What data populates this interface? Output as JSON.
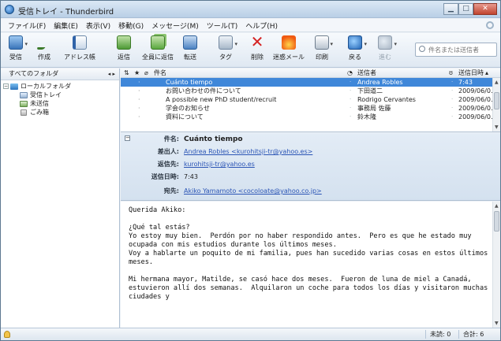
{
  "window": {
    "title": "受信トレイ - Thunderbird"
  },
  "menu": [
    "ファイル(F)",
    "編集(E)",
    "表示(V)",
    "移動(G)",
    "メッセージ(M)",
    "ツール(T)",
    "ヘルプ(H)"
  ],
  "toolbar": {
    "get": "受信",
    "write": "作成",
    "addressbook": "アドレス帳",
    "reply": "返信",
    "replyall": "全員に返信",
    "forward": "転送",
    "tag": "タグ",
    "delete": "削除",
    "junk": "迷惑メール",
    "print": "印刷",
    "back": "戻る",
    "forward_nav": "進む",
    "search_placeholder": "件名または送信者"
  },
  "folders": {
    "header": "すべてのフォルダ",
    "header_arrows": "◂ ▸",
    "items": [
      {
        "label": "ローカルフォルダ",
        "icon": "local-folders-icon"
      },
      {
        "label": "受信トレイ",
        "icon": "inbox-icon"
      },
      {
        "label": "未送信",
        "icon": "unsent-icon"
      },
      {
        "label": "ごみ箱",
        "icon": "trash-icon"
      }
    ]
  },
  "threads": {
    "columns": {
      "subject": "件名",
      "from": "送信者",
      "date": "送信日時"
    },
    "rows": [
      {
        "subject": "Cuánto tiempo",
        "from": "Andrea Robles",
        "date": "7:43",
        "selected": true
      },
      {
        "subject": "お問い合わせの件について",
        "from": "下田道二",
        "date": "2009/06/06 3...",
        "selected": false
      },
      {
        "subject": "A possible new PhD student/recruit",
        "from": "Rodrigo Cervantes",
        "date": "2009/06/06 2...",
        "selected": false
      },
      {
        "subject": "学会のお知らせ",
        "from": "事務局 佐藤",
        "date": "2009/06/06 2...",
        "selected": false
      },
      {
        "subject": "資料について",
        "from": "鈴木隆",
        "date": "2009/06/06 1...",
        "selected": false
      }
    ]
  },
  "message": {
    "subject_label": "件名:",
    "subject": "Cuánto tiempo",
    "from_label": "差出人:",
    "from": "Andrea Robles <kurohitsji-tr@yahoo.es>",
    "replyto_label": "返信先:",
    "replyto": "kurohitsji-tr@yahoo.es",
    "date_label": "送信日時:",
    "date": "7:43",
    "to_label": "宛先:",
    "to": "Akiko Yamamoto <cocoloate@yahoo.co.jp>",
    "body": "Querida Akiko:\n\n¿Qué tal estás?\nYo estoy muy bien.  Perdón por no haber respondido antes.  Pero es que he estado muy ocupada con mis estudios durante los últimos meses.\nVoy a hablarte un poquito de mi familia, pues han sucedido varias cosas en estos últimos meses.\n\nMi hermana mayor, Matilde, se casó hace dos meses.  Fueron de luna de miel a Canadá, estuvieron allí dos semanas.  Alquilaron un coche para todos los días y visitaron muchas ciudades y"
  },
  "status": {
    "unread": "未読: 0",
    "total": "合計: 6"
  }
}
